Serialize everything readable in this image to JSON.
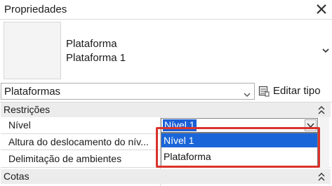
{
  "panel": {
    "title": "Propriedades"
  },
  "type_preview": {
    "family": "Plataforma",
    "type": "Plataforma 1"
  },
  "type_selector": {
    "value": "Plataformas",
    "edit_type_label": "Editar tipo"
  },
  "sections": [
    {
      "label": "Restrições",
      "params": [
        {
          "name": "Nível"
        },
        {
          "name": "Altura do deslocamento do nív..."
        },
        {
          "name": "Delimitação de ambientes"
        }
      ]
    },
    {
      "label": "Cotas"
    }
  ],
  "level_dropdown": {
    "selected": "Nível 1",
    "options": [
      "Nível 1",
      "Plataforma"
    ]
  },
  "colors": {
    "selection": "#1a66d8",
    "highlight": "#d9332b",
    "section_bg": "#ececec"
  }
}
